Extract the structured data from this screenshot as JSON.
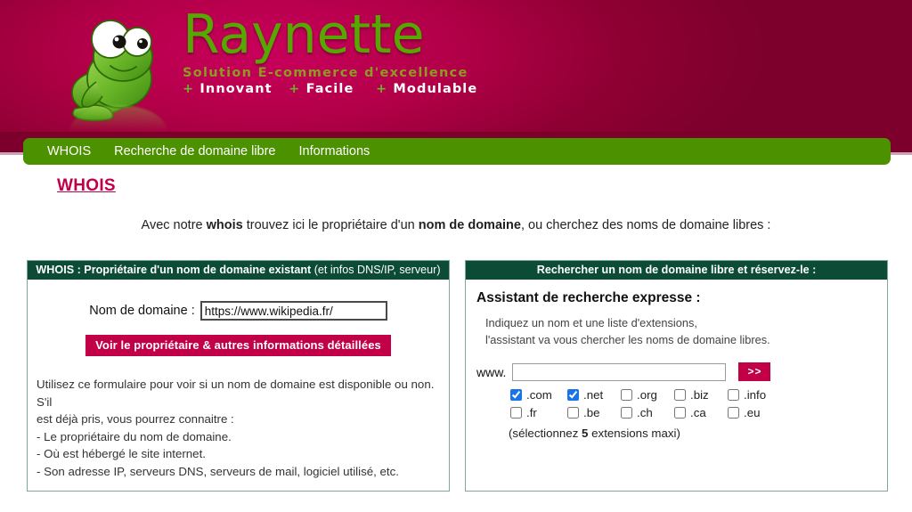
{
  "brand": {
    "name": "Raynette",
    "tagline1": "Solution E-commerce d'excellence",
    "tagline2_items": [
      "Innovant",
      "Facile",
      "Modulable"
    ],
    "plus_symbol": "+",
    "colors": {
      "banner_dark": "#7d002c",
      "banner_light": "#c9005c",
      "logo_green": "#56a800",
      "nav_green": "#4c9100",
      "accent_crimson": "#c20047",
      "panel_header_green": "#0c4c36",
      "panel_border": "#7fa898",
      "checkbox_blue": "#1a73e8"
    }
  },
  "nav": {
    "items": [
      {
        "label": "WHOIS"
      },
      {
        "label": "Recherche de domaine libre"
      },
      {
        "label": "Informations"
      }
    ]
  },
  "page": {
    "title": "WHOIS",
    "intro_prefix": "Avec notre ",
    "intro_bold1": "whois",
    "intro_mid": " trouvez ici le propriétaire d'un ",
    "intro_bold2": "nom de domaine",
    "intro_suffix": ", ou cherchez des noms de domaine libres :"
  },
  "left_panel": {
    "header_bold": "WHOIS : Propriétaire d'un nom de domaine existant",
    "header_light": " (et infos DNS/IP, serveur)",
    "field_label": "Nom de domaine :",
    "field_value": "https://www.wikipedia.fr/",
    "field_placeholder": "",
    "submit_label": "Voir le propriétaire & autres informations détaillées",
    "help_lines": [
      "Utilisez ce formulaire pour voir si un nom de domaine est disponible ou non. S'il",
      "est déjà pris, vous pourrez connaitre :",
      "- Le propriétaire du nom de domaine.",
      "- Où est hébergé le site internet.",
      "- Son adresse IP, serveurs DNS, serveurs de mail, logiciel utilisé, etc."
    ]
  },
  "right_panel": {
    "header": "Rechercher un nom de domaine libre et réservez-le :",
    "assistant_title": "Assistant de recherche expresse :",
    "assistant_sub_lines": [
      "Indiquez un nom et une liste d'extensions,",
      "l'assistant va vous chercher les noms de domaine libres."
    ],
    "www_label": "www.",
    "www_value": "",
    "www_placeholder": "",
    "go_label": ">>",
    "extensions": [
      {
        "label": ".com",
        "checked": true
      },
      {
        "label": ".net",
        "checked": true
      },
      {
        "label": ".org",
        "checked": false
      },
      {
        "label": ".biz",
        "checked": false
      },
      {
        "label": ".info",
        "checked": false
      },
      {
        "label": ".fr",
        "checked": false
      },
      {
        "label": ".be",
        "checked": false
      },
      {
        "label": ".ch",
        "checked": false
      },
      {
        "label": ".ca",
        "checked": false
      },
      {
        "label": ".eu",
        "checked": false
      }
    ],
    "note_prefix": "(sélectionnez ",
    "note_bold": "5",
    "note_suffix": " extensions maxi)"
  }
}
